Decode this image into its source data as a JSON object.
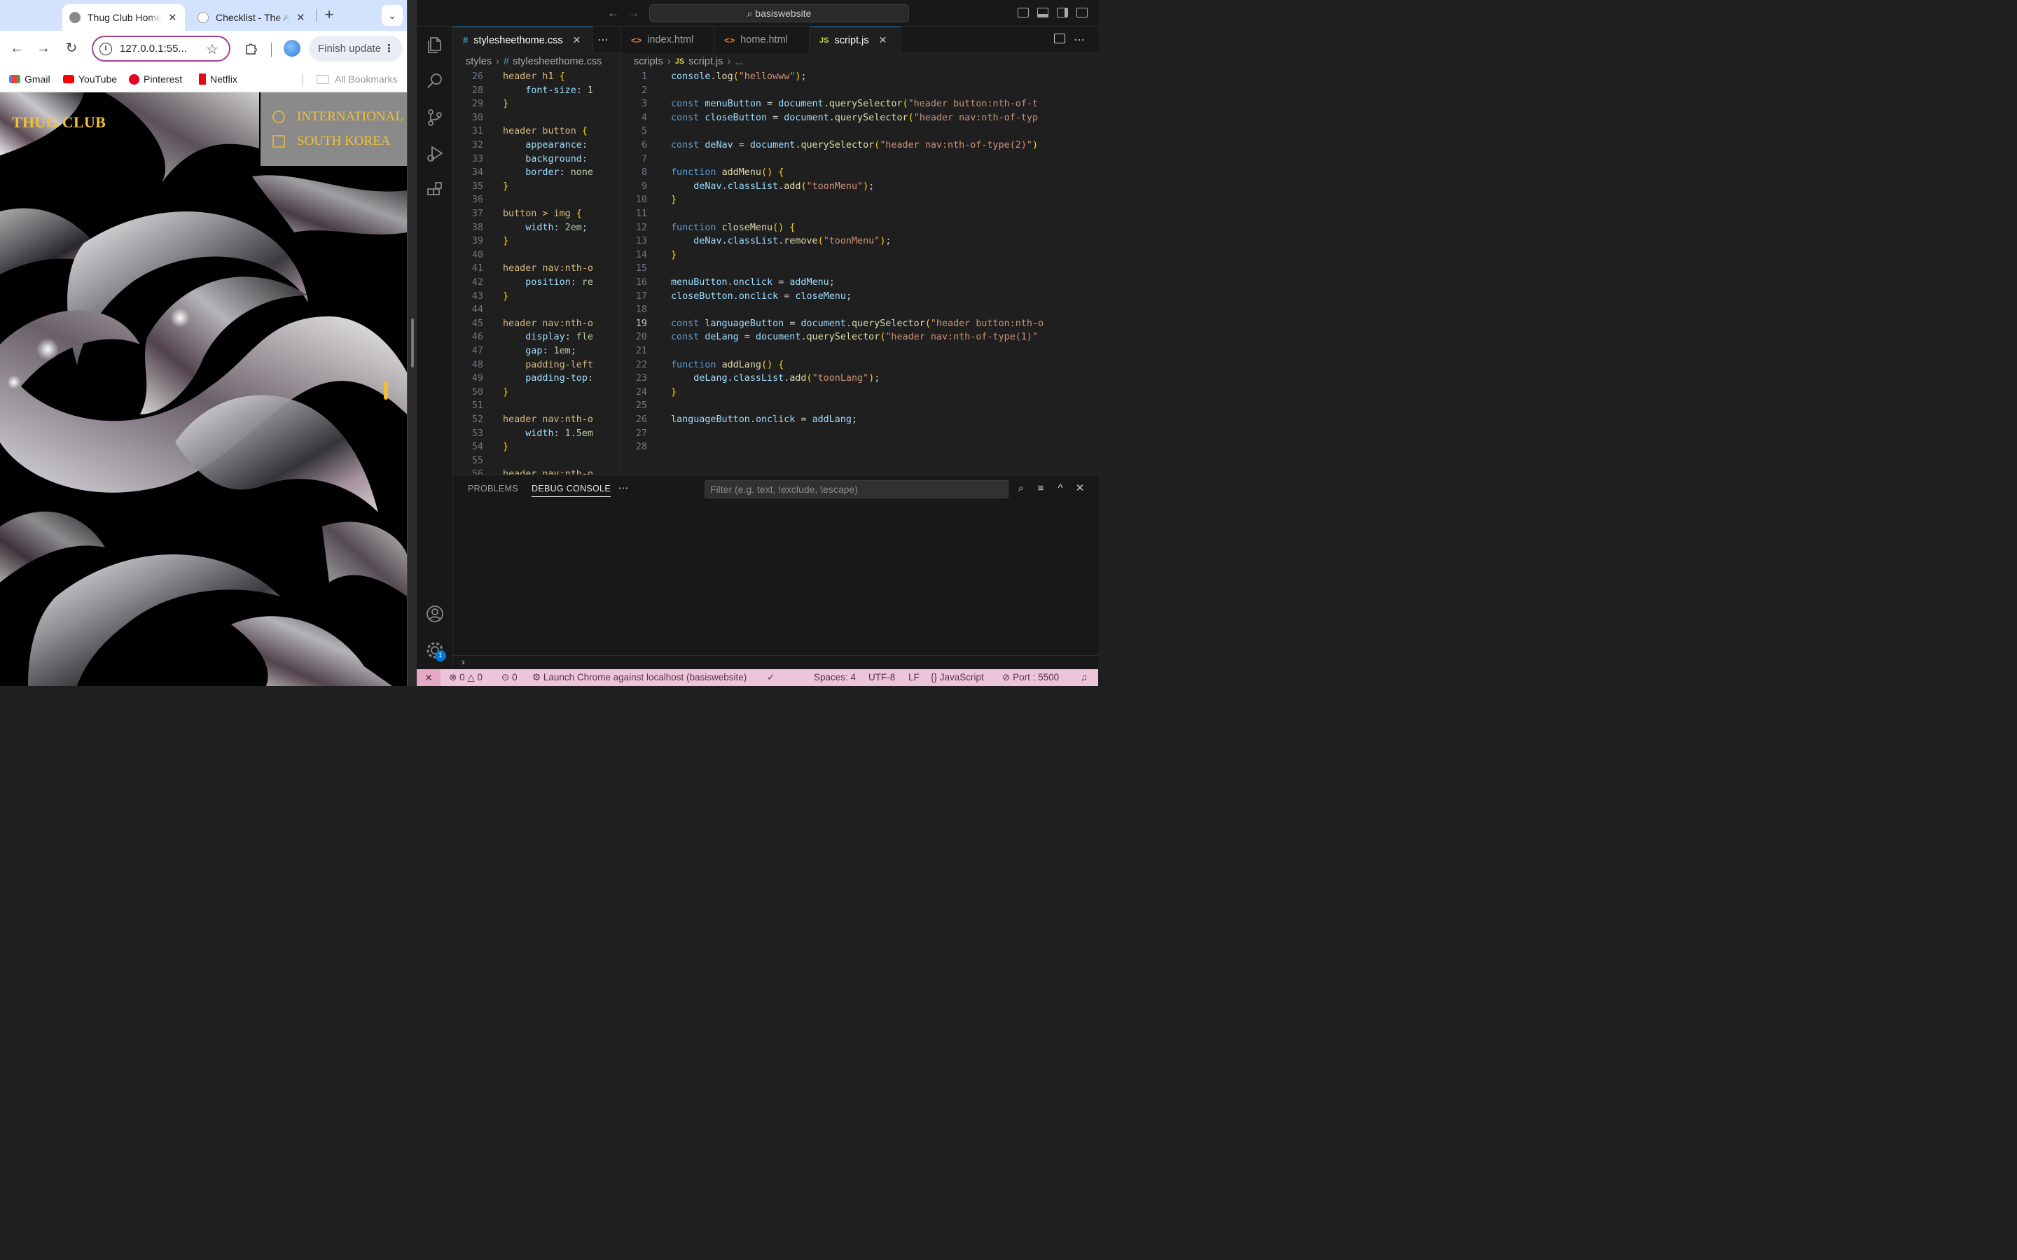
{
  "chrome": {
    "tabs": [
      {
        "title": "Thug Club Homepage",
        "active": true
      },
      {
        "title": "Checklist - The Art",
        "active": false
      }
    ],
    "url": "127.0.0.1:55...",
    "finish_update": "Finish update",
    "bookmarks": [
      "Gmail",
      "YouTube",
      "Pinterest",
      "Netflix"
    ],
    "all_bookmarks": "All Bookmarks",
    "page": {
      "site_title": "THUG CLUB",
      "languages": [
        "INTERNATIONAL",
        "SOUTH KOREA"
      ]
    }
  },
  "vscode": {
    "command_center": "basiswebsite",
    "left_group": {
      "tab": "stylesheethome.css",
      "breadcrumb": [
        "styles",
        "stylesheethome.css"
      ],
      "line_numbers": [
        "26",
        "28",
        "29",
        "30",
        "31",
        "32",
        "33",
        "34",
        "35",
        "36",
        "37",
        "38",
        "39",
        "40",
        "41",
        "42",
        "43",
        "44",
        "45",
        "46",
        "47",
        "48",
        "49",
        "50",
        "51",
        "52",
        "53",
        "54",
        "55",
        "56"
      ],
      "lines": [
        "header h1 {",
        "    font-size: 1",
        "}",
        "",
        "header button {",
        "    appearance: ",
        "    background: ",
        "    border: none",
        "}",
        "",
        "button > img {",
        "    width: 2em;",
        "}",
        "",
        "header nav:nth-o",
        "    position: re",
        "}",
        "",
        "header nav:nth-o",
        "    display: fle",
        "    gap: 1em;",
        "    padding-left",
        "    padding-top:",
        "}",
        "",
        "header nav:nth-o",
        "    width: 1.5em",
        "}",
        "",
        "header nav:nth-o"
      ]
    },
    "right_group": {
      "tabs": [
        "index.html",
        "home.html",
        "script.js"
      ],
      "active_tab": "script.js",
      "breadcrumb": [
        "scripts",
        "script.js",
        "..."
      ],
      "current_line": "19",
      "line_numbers": [
        "1",
        "2",
        "3",
        "4",
        "5",
        "6",
        "7",
        "8",
        "9",
        "10",
        "11",
        "12",
        "13",
        "14",
        "15",
        "16",
        "17",
        "18",
        "19",
        "20",
        "21",
        "22",
        "23",
        "24",
        "25",
        "26",
        "27",
        "28"
      ],
      "lines": [
        "console.log(\"hellowww\");",
        "",
        "const menuButton = document.querySelector(\"header button:nth-of-t",
        "const closeButton = document.querySelector(\"header nav:nth-of-typ",
        "",
        "const deNav = document.querySelector(\"header nav:nth-of-type(2)\")",
        "",
        "function addMenu() {",
        "    deNav.classList.add(\"toonMenu\");",
        "}",
        "",
        "function closeMenu() {",
        "    deNav.classList.remove(\"toonMenu\");",
        "}",
        "",
        "menuButton.onclick = addMenu;",
        "closeButton.onclick = closeMenu;",
        "",
        "const languageButton = document.querySelector(\"header button:nth-o",
        "const deLang = document.querySelector(\"header nav:nth-of-type(1)\"",
        "",
        "function addLang() {",
        "    deLang.classList.add(\"toonLang\");",
        "}",
        "",
        "languageButton.onclick = addLang;",
        "",
        ""
      ]
    },
    "panel": {
      "tabs": [
        "PROBLEMS",
        "DEBUG CONSOLE"
      ],
      "active_tab": "DEBUG CONSOLE",
      "filter_placeholder": "Filter (e.g. text, !exclude, \\escape)"
    },
    "statusbar": {
      "errors": "0",
      "warnings": "0",
      "ports": "0",
      "launch": "Launch Chrome against localhost (basiswebsite)",
      "spaces": "Spaces: 4",
      "encoding": "UTF-8",
      "eol": "LF",
      "language": "JavaScript",
      "port": "Port : 5500"
    },
    "accounts_badge": "1"
  },
  "colors": {
    "site_accent": "#f2c035",
    "status_bar": "#ecc6d8",
    "vscode_bg": "#1f1f1f"
  }
}
